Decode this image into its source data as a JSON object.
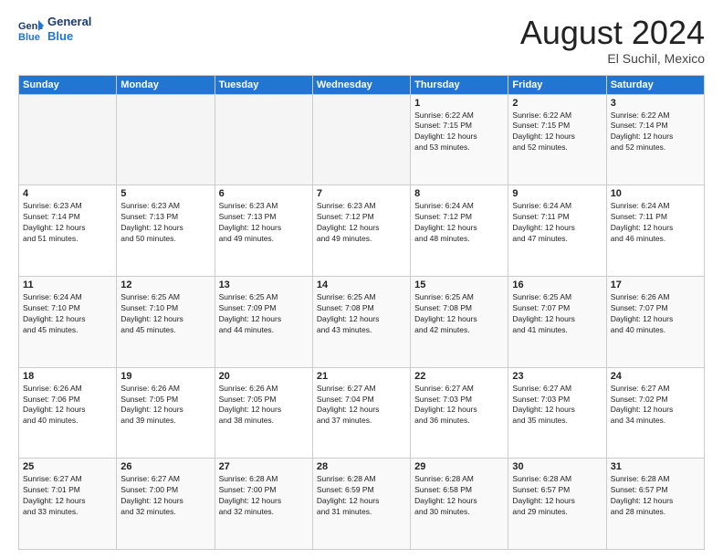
{
  "header": {
    "logo_line1": "General",
    "logo_line2": "Blue",
    "month": "August 2024",
    "location": "El Suchil, Mexico"
  },
  "days": [
    "Sunday",
    "Monday",
    "Tuesday",
    "Wednesday",
    "Thursday",
    "Friday",
    "Saturday"
  ],
  "weeks": [
    [
      {
        "num": "",
        "info": ""
      },
      {
        "num": "",
        "info": ""
      },
      {
        "num": "",
        "info": ""
      },
      {
        "num": "",
        "info": ""
      },
      {
        "num": "1",
        "info": "Sunrise: 6:22 AM\nSunset: 7:15 PM\nDaylight: 12 hours\nand 53 minutes."
      },
      {
        "num": "2",
        "info": "Sunrise: 6:22 AM\nSunset: 7:15 PM\nDaylight: 12 hours\nand 52 minutes."
      },
      {
        "num": "3",
        "info": "Sunrise: 6:22 AM\nSunset: 7:14 PM\nDaylight: 12 hours\nand 52 minutes."
      }
    ],
    [
      {
        "num": "4",
        "info": "Sunrise: 6:23 AM\nSunset: 7:14 PM\nDaylight: 12 hours\nand 51 minutes."
      },
      {
        "num": "5",
        "info": "Sunrise: 6:23 AM\nSunset: 7:13 PM\nDaylight: 12 hours\nand 50 minutes."
      },
      {
        "num": "6",
        "info": "Sunrise: 6:23 AM\nSunset: 7:13 PM\nDaylight: 12 hours\nand 49 minutes."
      },
      {
        "num": "7",
        "info": "Sunrise: 6:23 AM\nSunset: 7:12 PM\nDaylight: 12 hours\nand 49 minutes."
      },
      {
        "num": "8",
        "info": "Sunrise: 6:24 AM\nSunset: 7:12 PM\nDaylight: 12 hours\nand 48 minutes."
      },
      {
        "num": "9",
        "info": "Sunrise: 6:24 AM\nSunset: 7:11 PM\nDaylight: 12 hours\nand 47 minutes."
      },
      {
        "num": "10",
        "info": "Sunrise: 6:24 AM\nSunset: 7:11 PM\nDaylight: 12 hours\nand 46 minutes."
      }
    ],
    [
      {
        "num": "11",
        "info": "Sunrise: 6:24 AM\nSunset: 7:10 PM\nDaylight: 12 hours\nand 45 minutes."
      },
      {
        "num": "12",
        "info": "Sunrise: 6:25 AM\nSunset: 7:10 PM\nDaylight: 12 hours\nand 45 minutes."
      },
      {
        "num": "13",
        "info": "Sunrise: 6:25 AM\nSunset: 7:09 PM\nDaylight: 12 hours\nand 44 minutes."
      },
      {
        "num": "14",
        "info": "Sunrise: 6:25 AM\nSunset: 7:08 PM\nDaylight: 12 hours\nand 43 minutes."
      },
      {
        "num": "15",
        "info": "Sunrise: 6:25 AM\nSunset: 7:08 PM\nDaylight: 12 hours\nand 42 minutes."
      },
      {
        "num": "16",
        "info": "Sunrise: 6:25 AM\nSunset: 7:07 PM\nDaylight: 12 hours\nand 41 minutes."
      },
      {
        "num": "17",
        "info": "Sunrise: 6:26 AM\nSunset: 7:07 PM\nDaylight: 12 hours\nand 40 minutes."
      }
    ],
    [
      {
        "num": "18",
        "info": "Sunrise: 6:26 AM\nSunset: 7:06 PM\nDaylight: 12 hours\nand 40 minutes."
      },
      {
        "num": "19",
        "info": "Sunrise: 6:26 AM\nSunset: 7:05 PM\nDaylight: 12 hours\nand 39 minutes."
      },
      {
        "num": "20",
        "info": "Sunrise: 6:26 AM\nSunset: 7:05 PM\nDaylight: 12 hours\nand 38 minutes."
      },
      {
        "num": "21",
        "info": "Sunrise: 6:27 AM\nSunset: 7:04 PM\nDaylight: 12 hours\nand 37 minutes."
      },
      {
        "num": "22",
        "info": "Sunrise: 6:27 AM\nSunset: 7:03 PM\nDaylight: 12 hours\nand 36 minutes."
      },
      {
        "num": "23",
        "info": "Sunrise: 6:27 AM\nSunset: 7:03 PM\nDaylight: 12 hours\nand 35 minutes."
      },
      {
        "num": "24",
        "info": "Sunrise: 6:27 AM\nSunset: 7:02 PM\nDaylight: 12 hours\nand 34 minutes."
      }
    ],
    [
      {
        "num": "25",
        "info": "Sunrise: 6:27 AM\nSunset: 7:01 PM\nDaylight: 12 hours\nand 33 minutes."
      },
      {
        "num": "26",
        "info": "Sunrise: 6:27 AM\nSunset: 7:00 PM\nDaylight: 12 hours\nand 32 minutes."
      },
      {
        "num": "27",
        "info": "Sunrise: 6:28 AM\nSunset: 7:00 PM\nDaylight: 12 hours\nand 32 minutes."
      },
      {
        "num": "28",
        "info": "Sunrise: 6:28 AM\nSunset: 6:59 PM\nDaylight: 12 hours\nand 31 minutes."
      },
      {
        "num": "29",
        "info": "Sunrise: 6:28 AM\nSunset: 6:58 PM\nDaylight: 12 hours\nand 30 minutes."
      },
      {
        "num": "30",
        "info": "Sunrise: 6:28 AM\nSunset: 6:57 PM\nDaylight: 12 hours\nand 29 minutes."
      },
      {
        "num": "31",
        "info": "Sunrise: 6:28 AM\nSunset: 6:57 PM\nDaylight: 12 hours\nand 28 minutes."
      }
    ]
  ]
}
